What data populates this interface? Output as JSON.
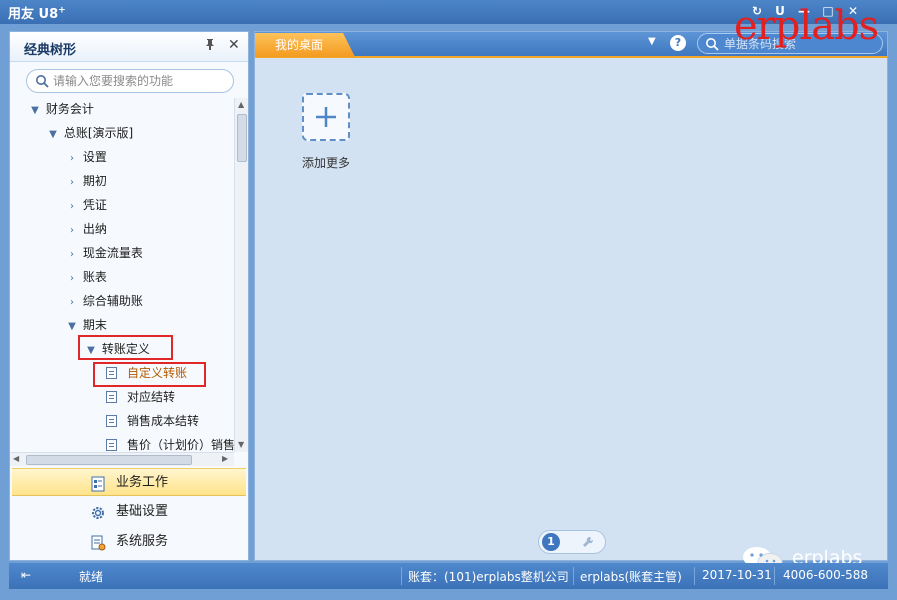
{
  "app": {
    "logo": "用友 U8",
    "logo_sup": "+"
  },
  "window_controls": [
    "↻",
    "U",
    "—",
    "□",
    "✕"
  ],
  "left_panel": {
    "title": "经典树形",
    "search_placeholder": "请输入您要搜索的功能",
    "tree": [
      {
        "label": "财务会计",
        "level": 0,
        "state": "expanded"
      },
      {
        "label": "总账[演示版]",
        "level": 1,
        "state": "expanded"
      },
      {
        "label": "设置",
        "level": 2,
        "state": "collapsed"
      },
      {
        "label": "期初",
        "level": 2,
        "state": "collapsed"
      },
      {
        "label": "凭证",
        "level": 2,
        "state": "collapsed"
      },
      {
        "label": "出纳",
        "level": 2,
        "state": "collapsed"
      },
      {
        "label": "现金流量表",
        "level": 2,
        "state": "collapsed"
      },
      {
        "label": "账表",
        "level": 2,
        "state": "collapsed"
      },
      {
        "label": "综合辅助账",
        "level": 2,
        "state": "collapsed"
      },
      {
        "label": "期末",
        "level": 2,
        "state": "expanded"
      },
      {
        "label": "转账定义",
        "level": 3,
        "state": "expanded"
      },
      {
        "label": "自定义转账",
        "level": 4,
        "state": "leaf",
        "selected": true
      },
      {
        "label": "对应结转",
        "level": 4,
        "state": "leaf"
      },
      {
        "label": "销售成本结转",
        "level": 4,
        "state": "leaf"
      },
      {
        "label": "售价（计划价）销售",
        "level": 4,
        "state": "leaf"
      }
    ],
    "nav": [
      {
        "label": "业务工作",
        "icon": "business-icon",
        "active": true
      },
      {
        "label": "基础设置",
        "icon": "gear-icon",
        "active": false
      },
      {
        "label": "系统服务",
        "icon": "system-service-icon",
        "active": false
      }
    ]
  },
  "right_panel": {
    "tab": "我的桌面",
    "search_placeholder": "单据条码搜索",
    "add_tile_label": "添加更多",
    "page_number": "1"
  },
  "watermark": {
    "top": "erplabs",
    "bottom": "erplabs"
  },
  "status_bar": {
    "ready": "就绪",
    "account": "账套：(101)erplabs整机公司",
    "user": "erplabs(账套主管)",
    "date": "2017-10-31",
    "phone": "4006-600-588"
  },
  "colors": {
    "accent_orange": "#f39b20",
    "title_blue": "#3f77bf",
    "highlight_red": "#e02828",
    "selected_text": "#b35a00"
  }
}
